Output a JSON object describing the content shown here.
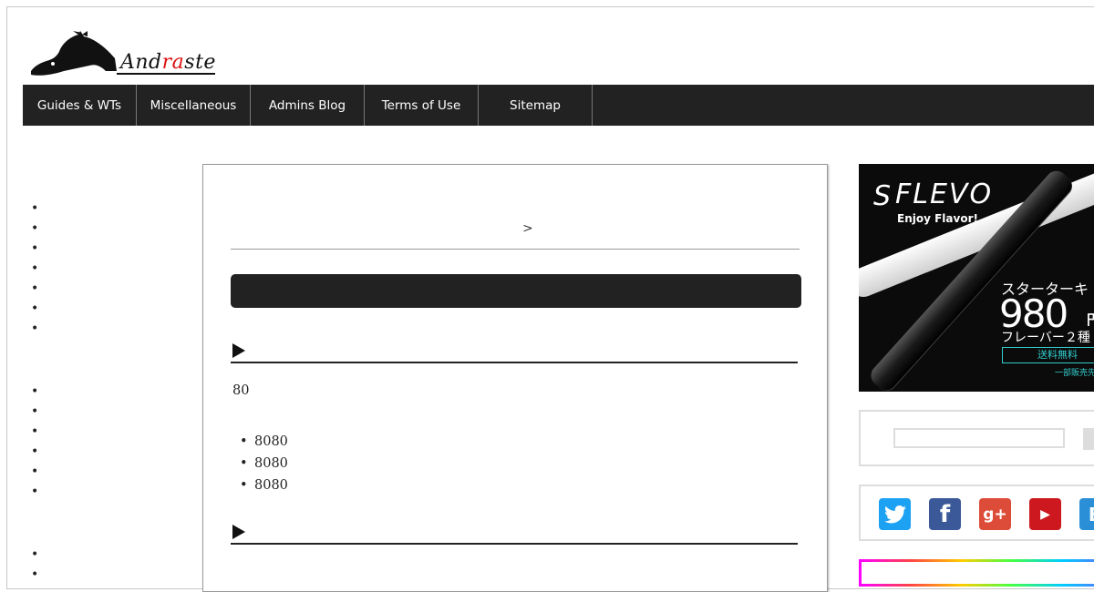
{
  "logo": {
    "text_before": "And",
    "text_red": "ra",
    "text_after": "ste"
  },
  "nav": {
    "items": [
      "Guides & WTs",
      "Miscellaneous",
      "Admins Blog",
      "Terms of Use",
      "Sitemap"
    ]
  },
  "breadcrumb": {
    "separator": ">"
  },
  "article": {
    "paragraph": "80",
    "list": [
      "8080",
      "8080",
      "8080"
    ]
  },
  "ad": {
    "brand": "FLEVO",
    "brand_mark": "S",
    "tagline": "Enjoy Flavor!",
    "jp_line1": "スターターキ",
    "price": "980",
    "price_unit": "円",
    "jp_line2": "フレーバー２種",
    "free_shipping": "送料無料",
    "note": "一部販売先"
  },
  "social": {
    "icons": [
      "twitter-icon",
      "facebook-icon",
      "google-plus-icon",
      "youtube-icon",
      "blogger-icon"
    ],
    "colors": [
      "#1da1f2",
      "#3b5998",
      "#dd4b39",
      "#cc181e",
      "#2a8fd6"
    ],
    "glyphs": [
      "t",
      "f",
      "g+",
      "▶",
      "B"
    ]
  }
}
